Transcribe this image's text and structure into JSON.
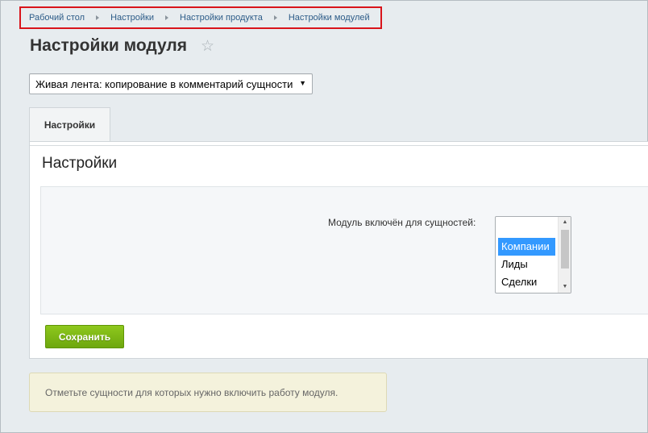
{
  "breadcrumb": {
    "items": [
      {
        "label": "Рабочий стол"
      },
      {
        "label": "Настройки"
      },
      {
        "label": "Настройки продукта"
      },
      {
        "label": "Настройки модулей"
      }
    ],
    "highlight_color": "#d9141b"
  },
  "header": {
    "title": "Настройки модуля",
    "favorite_icon": "star-icon"
  },
  "module_select": {
    "value": "Живая лента: копирование в комментарий сущности"
  },
  "tabs": [
    {
      "label": "Настройки",
      "active": true
    }
  ],
  "panel": {
    "heading": "Настройки",
    "field_label": "Модуль включён для сущностей:",
    "entities": [
      {
        "label": "Компании",
        "selected": true
      },
      {
        "label": "Лиды",
        "selected": false
      },
      {
        "label": "Сделки",
        "selected": false
      }
    ],
    "save_label": "Сохранить"
  },
  "hint": {
    "text": "Отметьте сущности для которых нужно включить работу модуля."
  },
  "colors": {
    "accent_green": "#7bb614",
    "link_blue": "#2d5c88",
    "selection_blue": "#3399ff"
  }
}
